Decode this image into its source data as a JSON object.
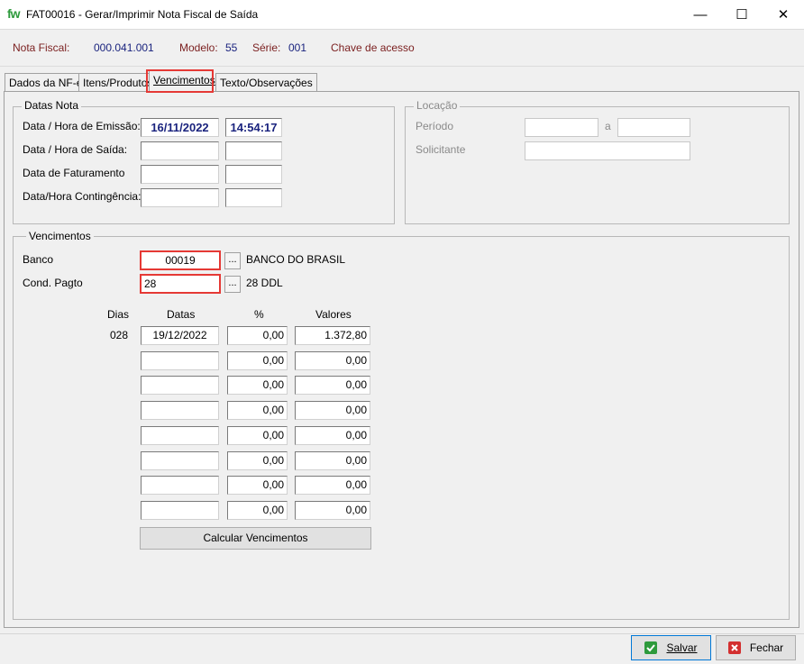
{
  "window": {
    "logo": "fw",
    "title": "FAT00016 - Gerar/Imprimir Nota Fiscal de Saída",
    "minimize": "—",
    "maximize": "☐",
    "close": "✕"
  },
  "header": {
    "nota_label": "Nota Fiscal:",
    "nota_value": "000.041.001",
    "modelo_label": "Modelo:",
    "modelo_value": "55",
    "serie_label": "Série:",
    "serie_value": "001",
    "chave_label": "Chave de acesso"
  },
  "tabs": [
    {
      "label": "Dados da NF-e"
    },
    {
      "label": "Itens/Produtos"
    },
    {
      "label": "Vencimentos"
    },
    {
      "label": "Texto/Observações"
    }
  ],
  "datas_nota": {
    "title": "Datas Nota",
    "emissao_label": "Data / Hora de Emissão:",
    "emissao_date": "16/11/2022",
    "emissao_time": "14:54:17",
    "saida_label": "Data / Hora de Saída:",
    "faturamento_label": "Data de Faturamento",
    "contingencia_label": "Data/Hora Contingência:"
  },
  "locacao": {
    "title": "Locação",
    "periodo_label": "Período",
    "a_label": "a",
    "solicitante_label": "Solicitante"
  },
  "vencimentos": {
    "title": "Vencimentos",
    "banco_label": "Banco",
    "banco_value": "00019",
    "banco_name": "BANCO DO BRASIL",
    "cond_label": "Cond. Pagto",
    "cond_value": "28",
    "cond_name": "28 DDL",
    "ellipsis": "...",
    "col_dias": "Dias",
    "col_datas": "Datas",
    "col_pct": "%",
    "col_valores": "Valores",
    "rows": [
      {
        "dias": "028",
        "data": "19/12/2022",
        "pct": "0,00",
        "valor": "1.372,80"
      },
      {
        "dias": "",
        "data": "",
        "pct": "0,00",
        "valor": "0,00"
      },
      {
        "dias": "",
        "data": "",
        "pct": "0,00",
        "valor": "0,00"
      },
      {
        "dias": "",
        "data": "",
        "pct": "0,00",
        "valor": "0,00"
      },
      {
        "dias": "",
        "data": "",
        "pct": "0,00",
        "valor": "0,00"
      },
      {
        "dias": "",
        "data": "",
        "pct": "0,00",
        "valor": "0,00"
      },
      {
        "dias": "",
        "data": "",
        "pct": "0,00",
        "valor": "0,00"
      },
      {
        "dias": "",
        "data": "",
        "pct": "0,00",
        "valor": "0,00"
      }
    ],
    "calc_button": "Calcular Vencimentos"
  },
  "footer": {
    "salvar": "Salvar",
    "fechar": "Fechar"
  },
  "colors": {
    "highlight": "#e53935",
    "label_red": "#7a1e1e",
    "value_blue": "#1a237e"
  }
}
